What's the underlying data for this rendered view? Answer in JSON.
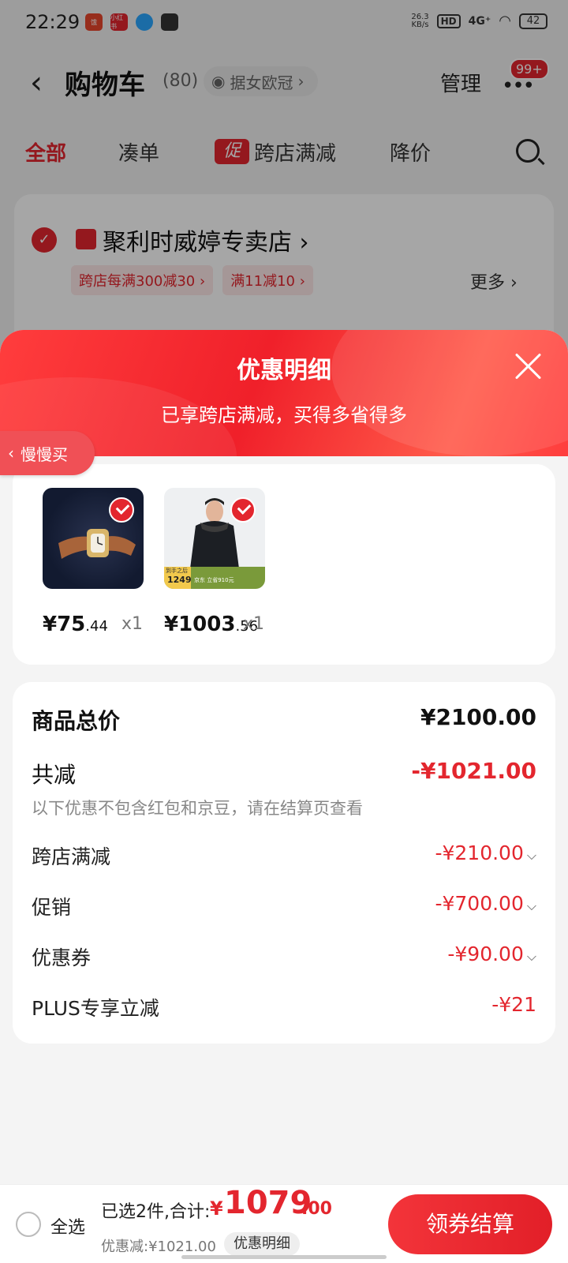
{
  "status_bar": {
    "time": "22:29",
    "speed": "26.3",
    "speed_unit": "KB/s",
    "hd": "HD",
    "network": "4G⁺",
    "battery": "42",
    "app1": "小红书"
  },
  "nav": {
    "title": "购物车",
    "count": "(80)",
    "address": "据女欧冠",
    "manage": "管理",
    "more_badge": "99+"
  },
  "tabs": {
    "all": "全部",
    "bundle": "凑单",
    "promo_badge": "促",
    "cross_store": "跨店满减",
    "price_drop": "降价"
  },
  "store": {
    "name": "聚利时威婷专卖店",
    "chips": [
      "跨店每满300减30",
      "满11减10"
    ],
    "more": "更多"
  },
  "sheet": {
    "title": "优惠明细",
    "subtitle": "已享跨店满减，买得多省得多",
    "slow_buy": "慢慢买"
  },
  "items": [
    {
      "price_int": "¥75",
      "price_dec": ".44",
      "qty": "x1",
      "image": "watch"
    },
    {
      "price_int": "¥1003",
      "price_dec": ".56",
      "qty": "x1",
      "image": "jacket",
      "tag_price": "1249",
      "tag_label": "到手之后",
      "tag_banner": "京东 立省910元"
    }
  ],
  "summary": {
    "total_label": "商品总价",
    "total_value": "¥2100.00",
    "reduce_label": "共减",
    "reduce_value": "-¥1021.00",
    "note": "以下优惠不包含红包和京豆，请在结算页查看",
    "lines": [
      {
        "label": "跨店满减",
        "value": "-¥210.00",
        "expand": true
      },
      {
        "label": "促销",
        "value": "-¥700.00",
        "expand": true
      },
      {
        "label": "优惠券",
        "value": "-¥90.00",
        "expand": true
      },
      {
        "label": "PLUS专享立减",
        "value": "-¥21",
        "expand": false
      }
    ]
  },
  "bar": {
    "select_all": "全选",
    "selected": "已选2件,合计:",
    "yen": "¥",
    "amount": "1079",
    "cents": ".00",
    "discount": "优惠减:¥1021.00",
    "detail": "优惠明细",
    "checkout": "领券结算"
  },
  "colors": {
    "accent": "#e3262e"
  }
}
